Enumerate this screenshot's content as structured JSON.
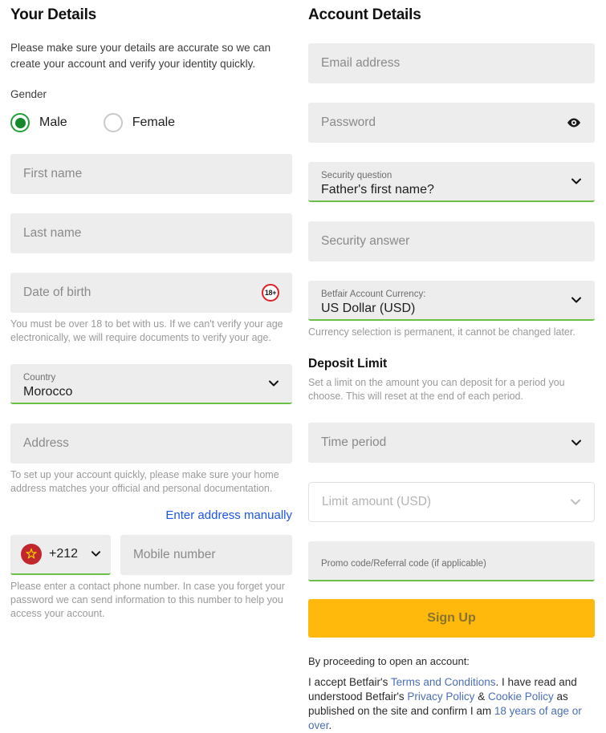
{
  "left": {
    "title": "Your Details",
    "intro": "Please make sure your details are accurate so we can create your account and verify your identity quickly.",
    "gender_label": "Gender",
    "gender_options": [
      {
        "label": "Male",
        "selected": true
      },
      {
        "label": "Female",
        "selected": false
      }
    ],
    "first_name_placeholder": "First name",
    "last_name_placeholder": "Last name",
    "dob_placeholder": "Date of birth",
    "dob_badge": "18+",
    "dob_helper": "You must be over 18 to bet with us. If we can't verify your age electronically, we will require documents to verify your age.",
    "country_label": "Country",
    "country_value": "Morocco",
    "address_placeholder": "Address",
    "address_helper": "To set up your account quickly, please make sure your home address matches your official and personal documentation.",
    "enter_address_manually": "Enter address manually",
    "phone_prefix": "+212",
    "phone_flag": "morocco-flag-icon",
    "mobile_placeholder": "Mobile number",
    "phone_helper": "Please enter a contact phone number. In case you forget your password we can send information to this number to help you access your account."
  },
  "right": {
    "title": "Account Details",
    "email_placeholder": "Email address",
    "password_placeholder": "Password",
    "password_toggle_icon": "eye-icon",
    "security_question_label": "Security question",
    "security_question_value": "Father's first name?",
    "security_answer_placeholder": "Security answer",
    "currency_label": "Betfair Account Currency:",
    "currency_value": "US Dollar (USD)",
    "currency_helper": "Currency selection is permanent, it cannot be changed later.",
    "deposit_limit_title": "Deposit Limit",
    "deposit_limit_desc": "Set a limit on the amount you can deposit for a period you choose. This will reset at the end of each period.",
    "time_period_placeholder": "Time period",
    "limit_amount_placeholder": "Limit amount (USD)",
    "promo_label": "Promo code/Referral code (if applicable)",
    "signup_label": "Sign Up",
    "terms_lead": "By proceeding to open an account:",
    "terms": {
      "t1": "I accept Betfair's ",
      "link1": "Terms and Conditions",
      "t2": ". I have read and understood Betfair's ",
      "link2": "Privacy Policy",
      "t3": " & ",
      "link3": "Cookie Policy",
      "t4": " as published on the site and confirm I am ",
      "link4": "18 years of age or over",
      "t5": "."
    }
  },
  "colors": {
    "field_bg": "#ededed",
    "accent_green": "#6abf47",
    "radio_green": "#148a2c",
    "signup_amber": "#ffb80c",
    "link_blue": "#1a56e8",
    "terms_link_blue": "#4a6fb5",
    "badge_red": "#e01f26",
    "flag_red": "#c1272d",
    "flag_star": "#f5d000"
  }
}
